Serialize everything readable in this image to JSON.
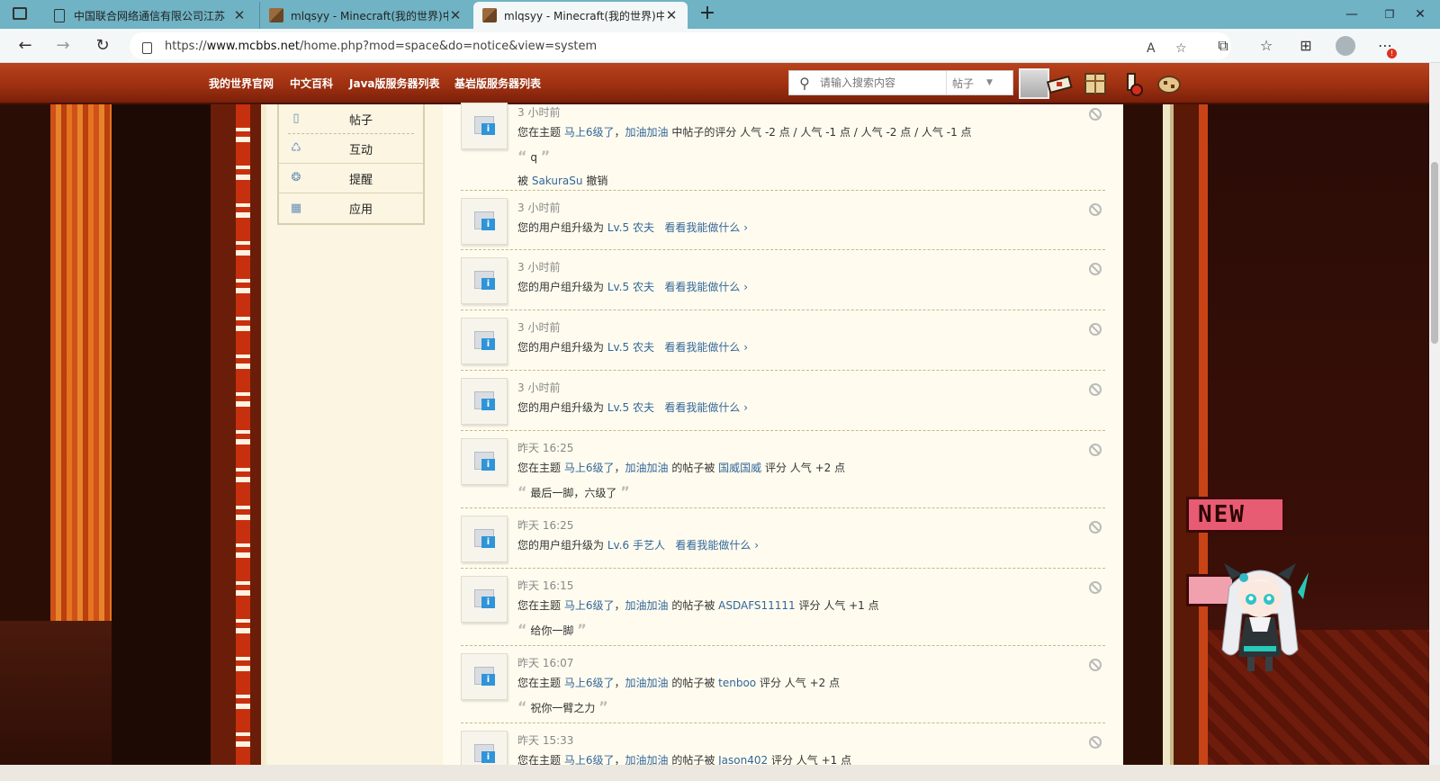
{
  "browser": {
    "tabs": [
      {
        "label": "中国联合网络通信有限公司江苏",
        "active": false
      },
      {
        "label": "mlqsyy - Minecraft(我的世界)中文",
        "active": false
      },
      {
        "label": "mlqsyy - Minecraft(我的世界)中文",
        "active": true
      }
    ],
    "url_prefix": "https://",
    "url_domain": "www.mcbbs.net",
    "url_path": "/home.php?mod=space&do=notice&view=system"
  },
  "site_nav": {
    "links": [
      "我的世界官网",
      "中文百科",
      "Java版服务器列表",
      "基岩版服务器列表"
    ],
    "search_placeholder": "请输入搜索内容",
    "search_type": "帖子"
  },
  "side_menu": {
    "items": [
      {
        "label": "帖子",
        "icon": "post-icon"
      },
      {
        "label": "互动",
        "icon": "interact-icon"
      },
      {
        "label": "提醒",
        "icon": "remind-icon"
      },
      {
        "label": "应用",
        "icon": "apps-icon"
      }
    ]
  },
  "notices": [
    {
      "time": "3 小时前",
      "pre": "您在主题 ",
      "link1": "马上6级了",
      "mid": "，",
      "link2": "加油加油",
      "post": " 中帖子的评分 人气 -2 点 / 人气 -1 点 / 人气 -2 点 / 人气 -1 点",
      "quote": "q",
      "extra_pre": "被 ",
      "extra_link": "SakuraSu",
      "extra_post": " 撤销"
    },
    {
      "time": "3 小时前",
      "pre": "您的用户组升级为 ",
      "link1": "Lv.5 农夫",
      "mid": "",
      "link2": "看看我能做什么 ›",
      "post": ""
    },
    {
      "time": "3 小时前",
      "pre": "您的用户组升级为 ",
      "link1": "Lv.5 农夫",
      "mid": "",
      "link2": "看看我能做什么 ›",
      "post": ""
    },
    {
      "time": "3 小时前",
      "pre": "您的用户组升级为 ",
      "link1": "Lv.5 农夫",
      "mid": "",
      "link2": "看看我能做什么 ›",
      "post": ""
    },
    {
      "time": "3 小时前",
      "pre": "您的用户组升级为 ",
      "link1": "Lv.5 农夫",
      "mid": "",
      "link2": "看看我能做什么 ›",
      "post": ""
    },
    {
      "time": "昨天 16:25",
      "pre": "您在主题 ",
      "link1": "马上6级了",
      "mid": "，",
      "link2": "加油加油",
      "post": " 的帖子被 ",
      "link3": "国威国威",
      "post2": " 评分 人气 +2 点",
      "quote": "最后一脚，六级了"
    },
    {
      "time": "昨天 16:25",
      "pre": "您的用户组升级为 ",
      "link1": "Lv.6 手艺人",
      "mid": "",
      "link2": "看看我能做什么 ›",
      "post": ""
    },
    {
      "time": "昨天 16:15",
      "pre": "您在主题 ",
      "link1": "马上6级了",
      "mid": "，",
      "link2": "加油加油",
      "post": " 的帖子被 ",
      "link3": "ASDAFS11111",
      "post2": " 评分 人气 +1 点",
      "quote": "给你一脚"
    },
    {
      "time": "昨天 16:07",
      "pre": "您在主题 ",
      "link1": "马上6级了",
      "mid": "，",
      "link2": "加油加油",
      "post": " 的帖子被 ",
      "link3": "tenboo",
      "post2": " 评分 人气 +2 点",
      "quote": "祝你一臂之力"
    },
    {
      "time": "昨天 15:33",
      "pre": "您在主题 ",
      "link1": "马上6级了",
      "mid": "，",
      "link2": "加油加油",
      "post": " 的帖子被 ",
      "link3": "Jason402",
      "post2": " 评分 人气 +1 点"
    }
  ],
  "mascot": {
    "tag": "NEW"
  },
  "colors": {
    "nav_red": "#9c2f10",
    "link_blue": "#336699",
    "paper": "#fffcef",
    "tab_bar": "#6fb3c4"
  }
}
